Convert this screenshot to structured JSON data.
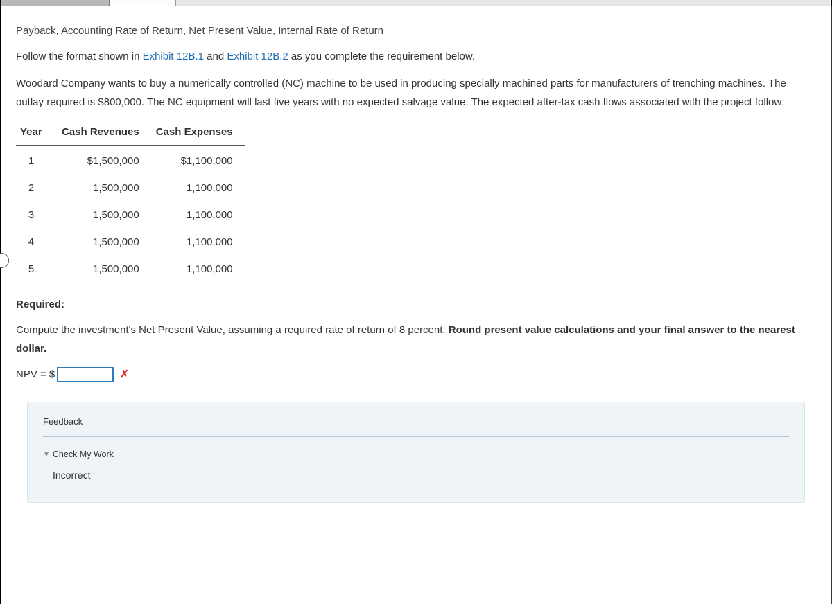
{
  "section_title": "Payback, Accounting Rate of Return, Net Present Value, Internal Rate of Return",
  "instruction_prefix": "Follow the format shown in ",
  "exhibit1": "Exhibit 12B.1",
  "instruction_mid": " and ",
  "exhibit2": "Exhibit 12B.2",
  "instruction_suffix": " as you complete the requirement below.",
  "problem_text": "Woodard Company wants to buy a numerically controlled (NC) machine to be used in producing specially machined parts for manufacturers of trenching machines. The outlay required is $800,000. The NC equipment will last five years with no expected salvage value. The expected after-tax cash flows associated with the project follow:",
  "table": {
    "headers": {
      "year": "Year",
      "rev": "Cash Revenues",
      "exp": "Cash Expenses"
    },
    "rows": [
      {
        "year": "1",
        "rev": "$1,500,000",
        "exp": "$1,100,000"
      },
      {
        "year": "2",
        "rev": "1,500,000",
        "exp": "1,100,000"
      },
      {
        "year": "3",
        "rev": "1,500,000",
        "exp": "1,100,000"
      },
      {
        "year": "4",
        "rev": "1,500,000",
        "exp": "1,100,000"
      },
      {
        "year": "5",
        "rev": "1,500,000",
        "exp": "1,100,000"
      }
    ]
  },
  "required_label": "Required:",
  "question_prefix": "Compute the investment's Net Present Value, assuming a required rate of return of 8 percent. ",
  "question_bold": "Round present value calculations and your final answer to the nearest dollar.",
  "npv_prefix": "NPV = $",
  "npv_value": "",
  "x_mark": "✗",
  "feedback": {
    "title": "Feedback",
    "check_label": "Check My Work",
    "result": "Incorrect"
  }
}
